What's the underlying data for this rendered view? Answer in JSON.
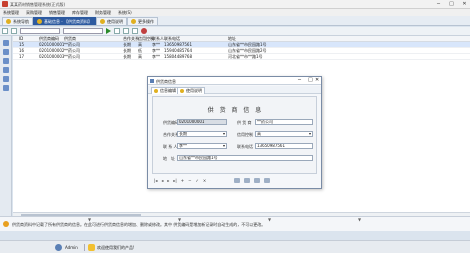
{
  "window": {
    "title": "某某药材销售管理系统(正式版)"
  },
  "menu": [
    "系统管理",
    "采购管理",
    "销售管理",
    "库存管理",
    "财务管理",
    "系统(S)"
  ],
  "tabs": [
    {
      "label": "系统导航",
      "active": false
    },
    {
      "label": "基础信息 - 【供货商资料】",
      "active": true
    },
    {
      "label": "使用说明",
      "active": false
    },
    {
      "label": "更多操作",
      "active": false
    }
  ],
  "grid": {
    "headers": [
      "ID",
      "供货商编码",
      "供货商",
      "合作关系",
      "信用控制",
      "联系人",
      "联系电话",
      "地址"
    ],
    "rows": [
      [
        "15",
        "0201000001",
        "**药公司",
        "长期",
        "高",
        "李**",
        "13650987561",
        "山东省**市民园路1号"
      ],
      [
        "16",
        "0201000002",
        "**药公司",
        "长期",
        "低",
        "李**",
        "15940485764",
        "山东省**市民园路2号"
      ],
      [
        "17",
        "0201000003",
        "**药公司",
        "长期",
        "高",
        "李**",
        "15804489768",
        "河北省**市**路1号"
      ]
    ]
  },
  "dialog": {
    "title": "供货商信息",
    "tabs": [
      "信息编辑",
      "使用说明"
    ],
    "heading": "供 货 商 信 息",
    "fields": {
      "code_label": "供货编码",
      "code_value": "0201000001",
      "name_label": "供 货 商",
      "name_value": "**药公司",
      "relation_label": "合作关系",
      "relation_value": "长期",
      "credit_label": "信用控制",
      "credit_value": "高",
      "contact_label": "联 系 人",
      "contact_value": "李**",
      "phone_label": "联系电话",
      "phone_value": "13650987561",
      "address_label": "地　址",
      "address_value": "山东省**市民园路1号"
    },
    "nav": [
      "|◂",
      "◂",
      "▸",
      "▸|",
      "+",
      "−",
      "✓",
      "×"
    ]
  },
  "status": {
    "message": "供货商资料中记载了所有供货商的信息。在此可进行供货商信息的增加、删除或修改。其中 供货编码是增加新记录时自动生成的，不可以更改。"
  },
  "taskbar": {
    "user": "Admin",
    "welcome": "欢迎使用我们的产品!"
  }
}
